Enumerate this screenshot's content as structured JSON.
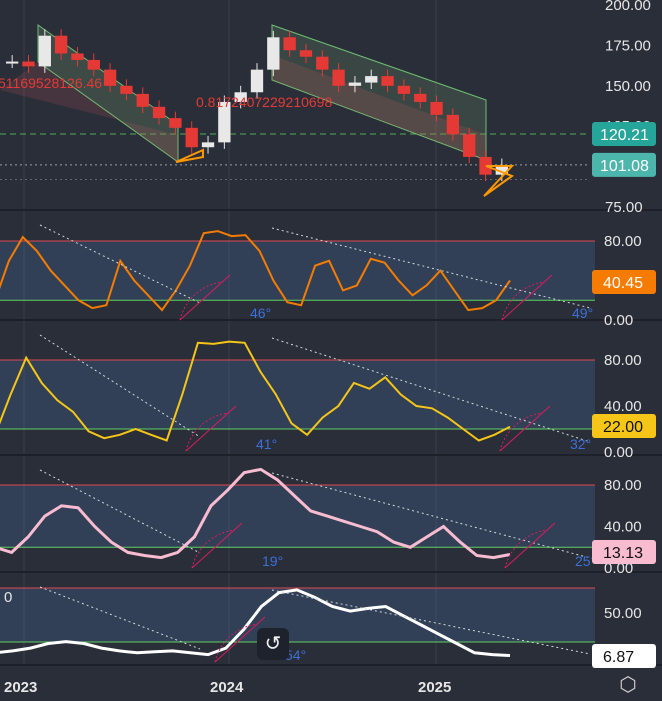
{
  "chart_data": [
    {
      "type": "candlestick",
      "panel": "price",
      "x": [
        "2023",
        "2024",
        "2025"
      ],
      "yticks": [
        75,
        100,
        125,
        150,
        175,
        200
      ],
      "ytick_labels": [
        "75.00",
        "100.00",
        "125.00",
        "150.00",
        "175.00",
        "200.00"
      ],
      "ylim": [
        75,
        200
      ],
      "dashed_level": 120.21,
      "price_tags": [
        {
          "label": "120.21",
          "value": 120.21,
          "color": "#26a69a"
        },
        {
          "label": "101.08",
          "value": 101.08,
          "color": "#4db6ac"
        }
      ],
      "annotations": [
        "51169528126.46",
        "0.8172407229210698"
      ],
      "closes": [
        {
          "x": "2022-11",
          "y": 165
        },
        {
          "x": "2022-12",
          "y": 162
        },
        {
          "x": "2023-01",
          "y": 181
        },
        {
          "x": "2023-02",
          "y": 170
        },
        {
          "x": "2023-03",
          "y": 166
        },
        {
          "x": "2023-04",
          "y": 160
        },
        {
          "x": "2023-05",
          "y": 150
        },
        {
          "x": "2023-06",
          "y": 145
        },
        {
          "x": "2023-07",
          "y": 137
        },
        {
          "x": "2023-08",
          "y": 130
        },
        {
          "x": "2023-09",
          "y": 124
        },
        {
          "x": "2023-10",
          "y": 112
        },
        {
          "x": "2023-11",
          "y": 115
        },
        {
          "x": "2023-12",
          "y": 140
        },
        {
          "x": "2024-01",
          "y": 146
        },
        {
          "x": "2024-02",
          "y": 160
        },
        {
          "x": "2024-03",
          "y": 180
        },
        {
          "x": "2024-04",
          "y": 172
        },
        {
          "x": "2024-05",
          "y": 168
        },
        {
          "x": "2024-06",
          "y": 160
        },
        {
          "x": "2024-07",
          "y": 150
        },
        {
          "x": "2024-08",
          "y": 152
        },
        {
          "x": "2024-09",
          "y": 156
        },
        {
          "x": "2024-10",
          "y": 150
        },
        {
          "x": "2024-11",
          "y": 145
        },
        {
          "x": "2024-12",
          "y": 140
        },
        {
          "x": "2025-01",
          "y": 132
        },
        {
          "x": "2025-02",
          "y": 120
        },
        {
          "x": "2025-03",
          "y": 106
        },
        {
          "x": "2025-04",
          "y": 95
        },
        {
          "x": "2025-05",
          "y": 101
        }
      ]
    },
    {
      "type": "line",
      "panel": "oscillator-1",
      "yticks": [
        0,
        40,
        80
      ],
      "ytick_labels": [
        "0.00",
        "40.00",
        "80.00"
      ],
      "current": {
        "label": "40.45",
        "color": "#f57c00"
      },
      "angles": [
        "46°",
        "49°"
      ],
      "values": [
        20,
        60,
        84,
        70,
        50,
        35,
        20,
        12,
        15,
        60,
        40,
        25,
        10,
        30,
        55,
        88,
        90,
        85,
        86,
        70,
        40,
        18,
        15,
        55,
        60,
        30,
        35,
        62,
        58,
        40,
        25,
        35,
        50,
        30,
        10,
        12,
        20,
        40
      ]
    },
    {
      "type": "line",
      "panel": "oscillator-2",
      "yticks": [
        0,
        40,
        80
      ],
      "ytick_labels": [
        "0.00",
        "40.00",
        "80.00"
      ],
      "current": {
        "label": "22.00",
        "color": "#f5c518"
      },
      "angles": [
        "41°",
        "32°"
      ],
      "values": [
        15,
        50,
        82,
        60,
        45,
        35,
        18,
        12,
        15,
        20,
        15,
        10,
        50,
        95,
        94,
        96,
        95,
        70,
        50,
        25,
        15,
        30,
        40,
        60,
        55,
        65,
        50,
        40,
        38,
        30,
        20,
        10,
        15,
        22
      ]
    },
    {
      "type": "line",
      "panel": "oscillator-3",
      "yticks": [
        0,
        40,
        80
      ],
      "ytick_labels": [
        "0.00",
        "40.00",
        "80.00"
      ],
      "current": {
        "label": "13.13",
        "color": "#f8bbd0"
      },
      "angles": [
        "19°",
        "25°"
      ],
      "values": [
        20,
        15,
        30,
        50,
        60,
        58,
        40,
        25,
        15,
        12,
        10,
        15,
        30,
        60,
        75,
        92,
        95,
        85,
        70,
        55,
        50,
        45,
        40,
        35,
        25,
        20,
        30,
        40,
        25,
        12,
        10,
        13
      ]
    },
    {
      "type": "line",
      "panel": "oscillator-4",
      "yticks": [
        50
      ],
      "ytick_labels": [
        "50.00"
      ],
      "current": {
        "label": "6.87",
        "color": "#ffffff"
      },
      "angles": [
        "54°"
      ],
      "left_label": "0",
      "values": [
        10,
        12,
        15,
        20,
        22,
        20,
        15,
        12,
        10,
        11,
        12,
        10,
        8,
        15,
        35,
        60,
        75,
        78,
        70,
        60,
        55,
        58,
        60,
        50,
        40,
        30,
        20,
        10,
        8,
        7
      ]
    }
  ],
  "buttons": {
    "reset_icon": "↺",
    "settings_icon": "⬡"
  }
}
